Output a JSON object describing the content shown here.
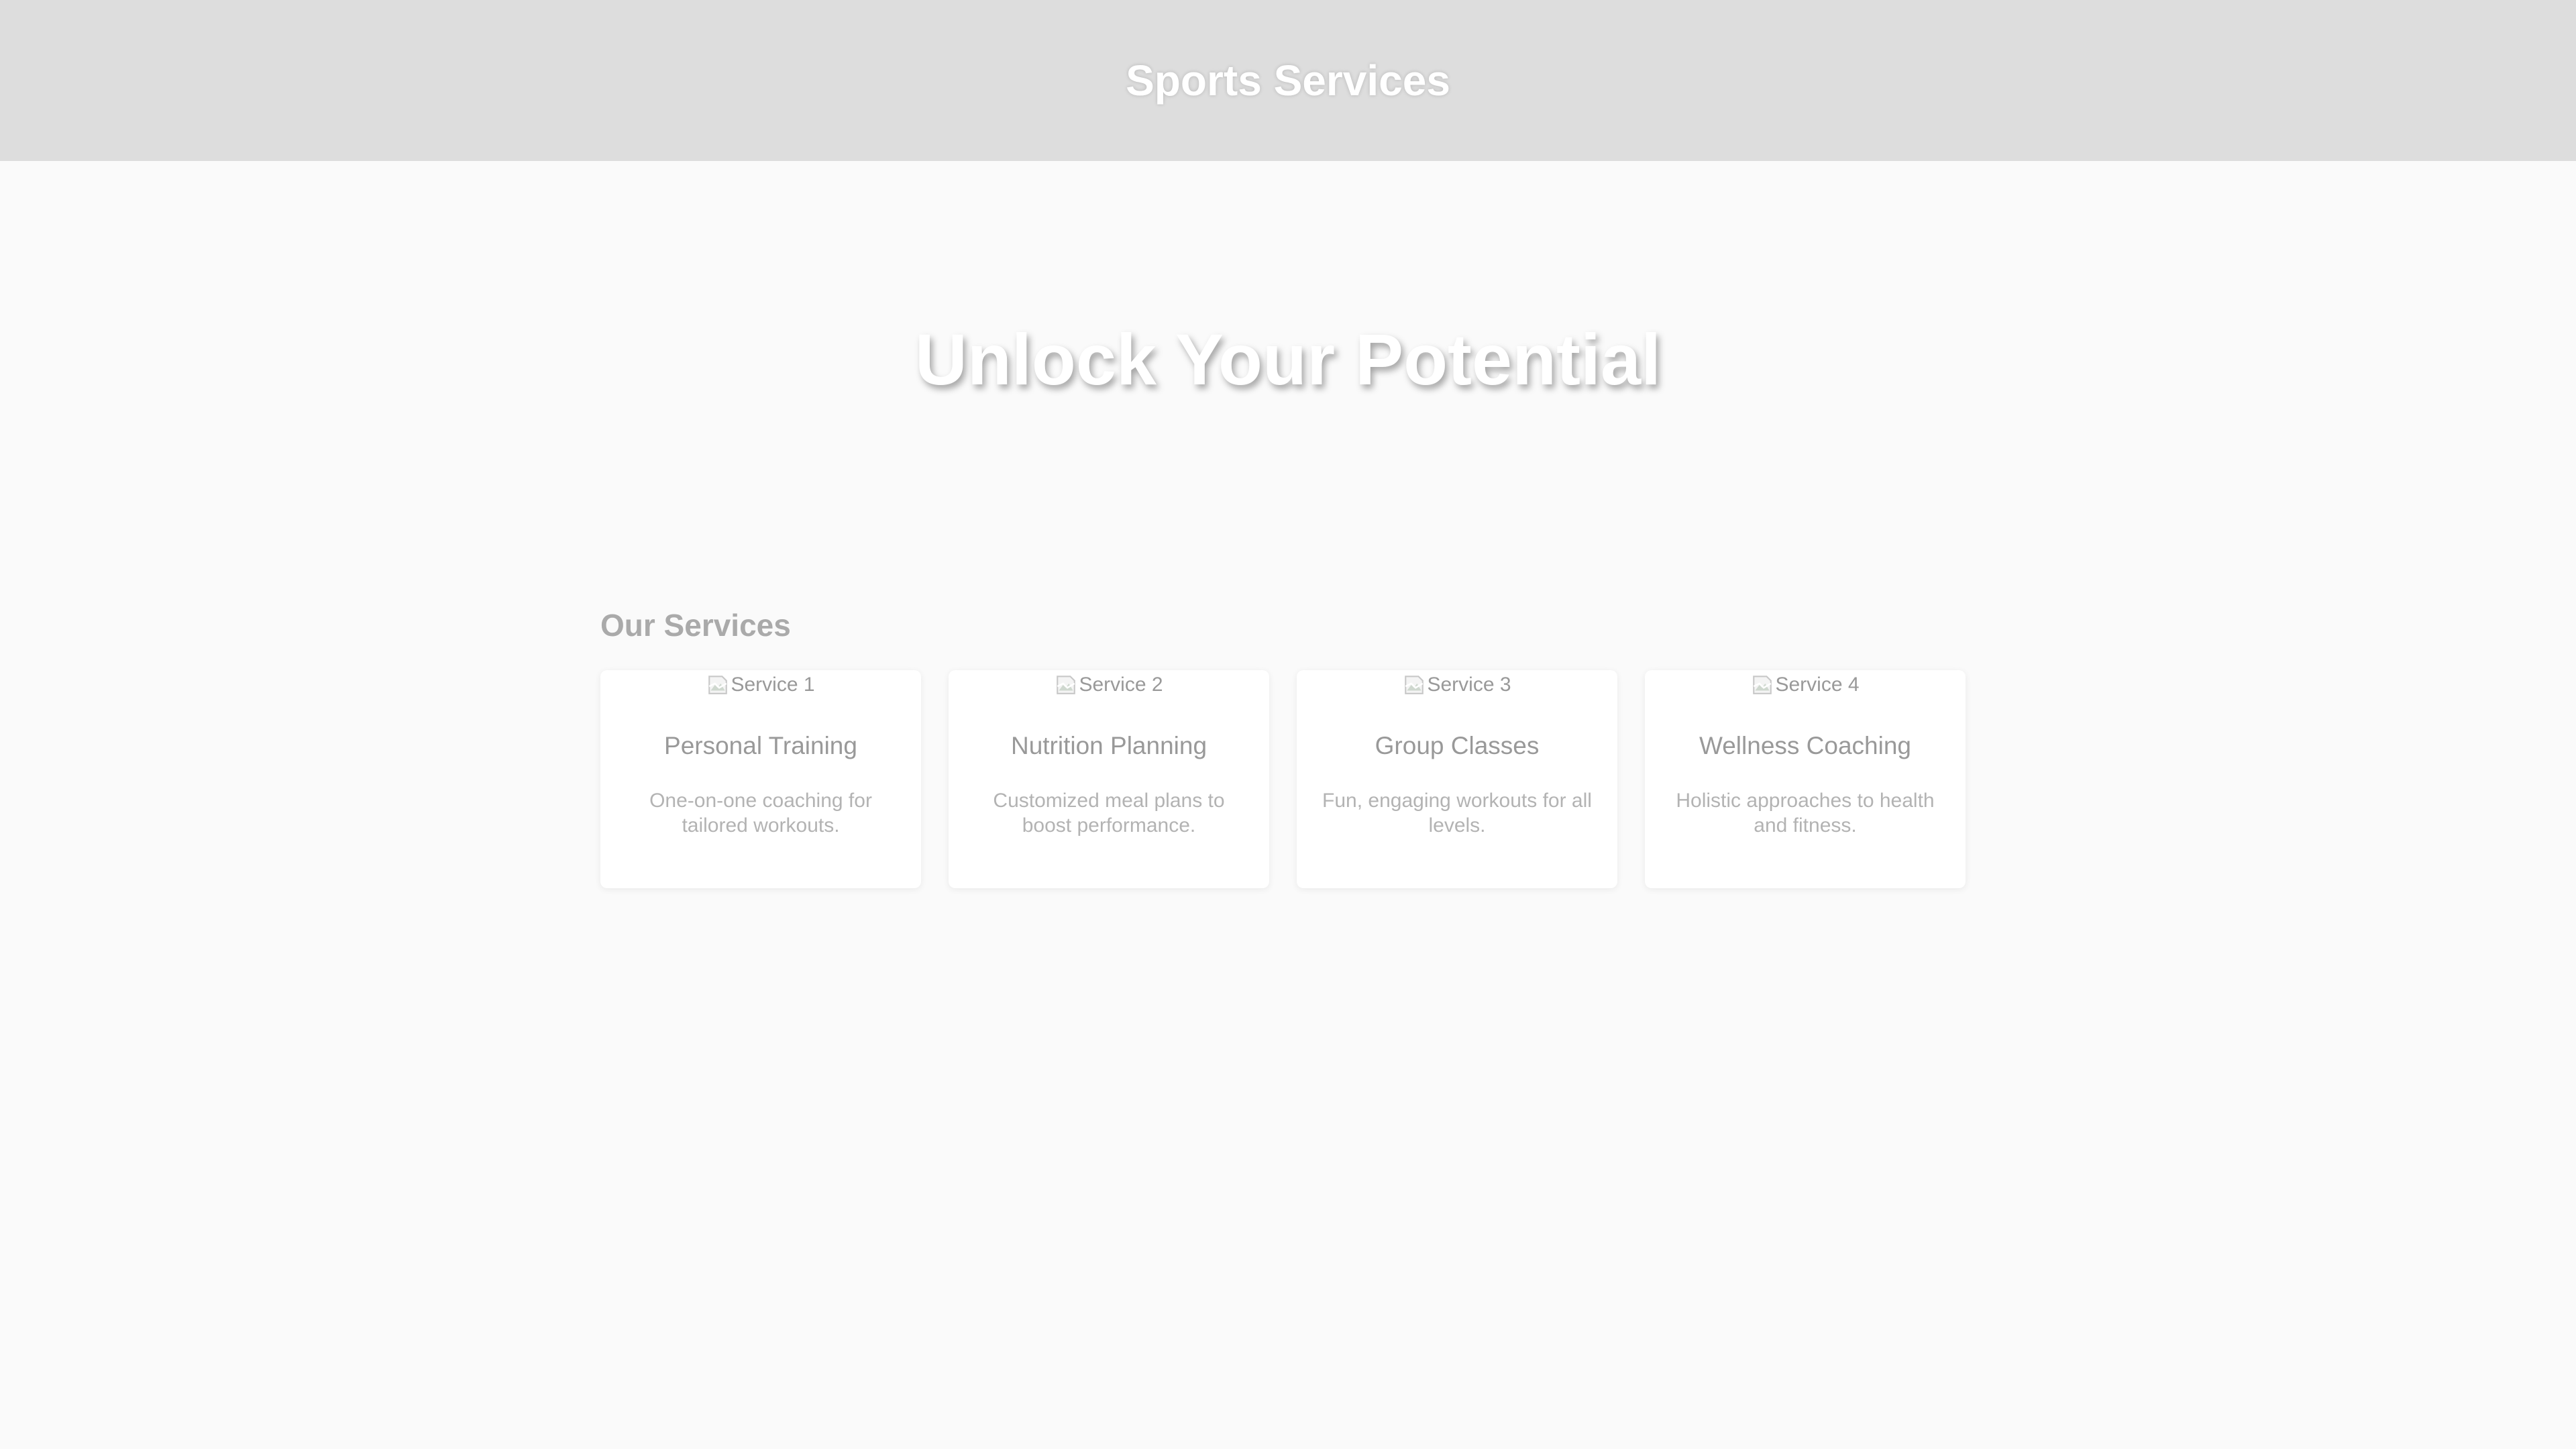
{
  "header": {
    "title": "Sports Services"
  },
  "hero": {
    "heading": "Unlock Your Potential"
  },
  "services": {
    "heading": "Our Services",
    "items": [
      {
        "image_alt": "Service 1",
        "title": "Personal Training",
        "description": "One-on-one coaching for tailored workouts."
      },
      {
        "image_alt": "Service 2",
        "title": "Nutrition Planning",
        "description": "Customized meal plans to boost performance."
      },
      {
        "image_alt": "Service 3",
        "title": "Group Classes",
        "description": "Fun, engaging workouts for all levels."
      },
      {
        "image_alt": "Service 4",
        "title": "Wellness Coaching",
        "description": "Holistic approaches to health and fitness."
      }
    ]
  },
  "icons": {
    "card_image": "broken-image-icon"
  },
  "colors": {
    "header_bg": "#dddddd",
    "page_bg": "#fafafa",
    "card_bg": "#ffffff",
    "muted_text": "#999999"
  }
}
